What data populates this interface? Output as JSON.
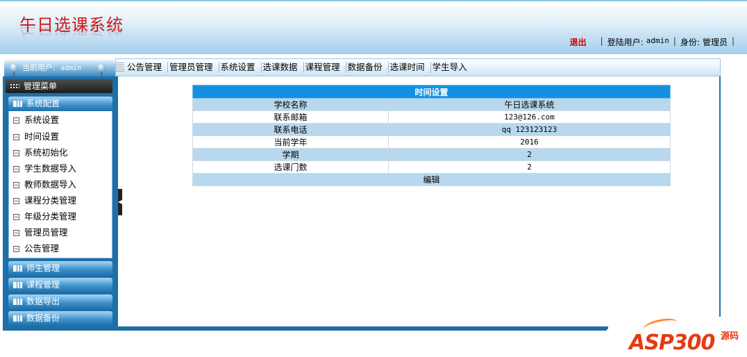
{
  "header": {
    "title": "午日选课系统",
    "logout_label": "退出",
    "login_user_label": "登陆用户:",
    "login_user": "admin",
    "role_label": "身份:",
    "role": "管理员"
  },
  "userbar": {
    "label": "当前用户:",
    "username": "admin"
  },
  "nav": {
    "items": [
      "公告管理",
      "管理员管理",
      "系统设置",
      "选课数据",
      "课程管理",
      "数据备份",
      "选课时间",
      "学生导入"
    ]
  },
  "sidebar": {
    "menu_title": "管理菜单",
    "sections": [
      "系统配置",
      "师生管理",
      "课程管理",
      "数据导出",
      "数据备份"
    ],
    "submenu": [
      "系统设置",
      "时间设置",
      "系统初始化",
      "学生数据导入",
      "教师数据导入",
      "课程分类管理",
      "年级分类管理",
      "管理员管理",
      "公告管理"
    ]
  },
  "settings": {
    "title": "时间设置",
    "rows": [
      {
        "label": "学校名称",
        "value": "午日选课系统"
      },
      {
        "label": "联系邮箱",
        "value": "123@126.com"
      },
      {
        "label": "联系电话",
        "value": "qq 123123123"
      },
      {
        "label": "当前学年",
        "value": "2016"
      },
      {
        "label": "学期",
        "value": "2"
      },
      {
        "label": "选课门数",
        "value": "2"
      }
    ],
    "edit_label": "编辑"
  },
  "watermark": {
    "text": "ASP300",
    "sub1": "源码",
    "sub2": ""
  },
  "colors": {
    "accent": "#1490e3",
    "sidebar": "#1e6fa8",
    "logout": "#d40000",
    "title": "#cc1b1b"
  }
}
